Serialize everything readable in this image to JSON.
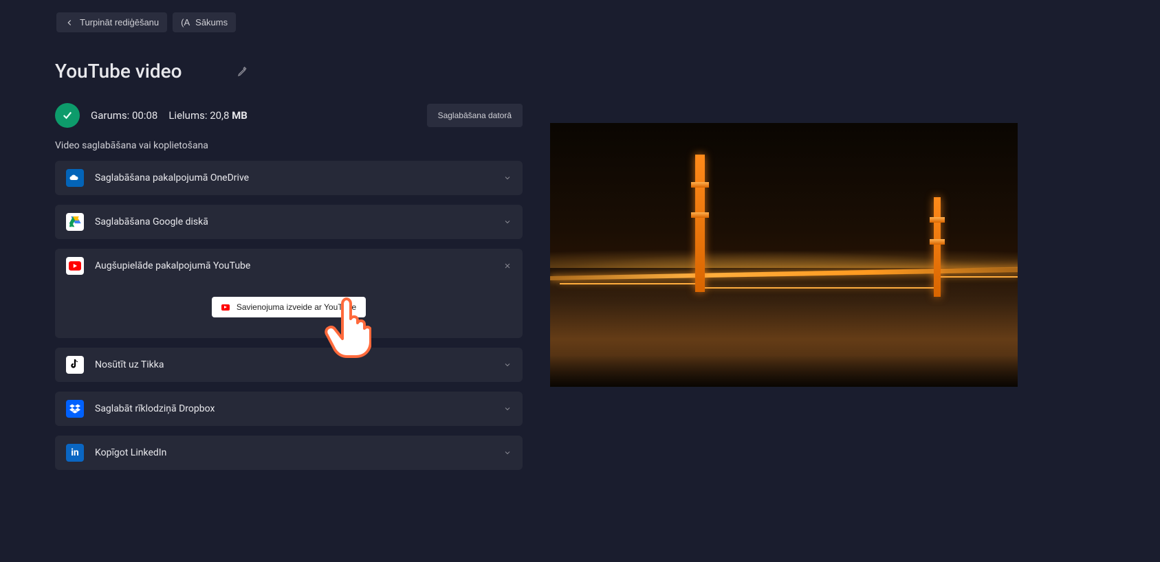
{
  "topbar": {
    "continue_editing": "Turpināt rediģēšanu",
    "home": "Sākums",
    "home_prefix": "(A"
  },
  "title": "YouTube video",
  "meta": {
    "duration_label": "Garums: 00:08",
    "size_label": "Lielums: 20,8",
    "size_unit": "MB"
  },
  "save_local_button": "Saglabāšana datorā",
  "subheading": "Video saglabāšana vai koplietošana",
  "options": [
    {
      "id": "onedrive",
      "label": "Saglabāšana pakalpojumā OneDrive",
      "expanded": false
    },
    {
      "id": "gdrive",
      "label": "Saglabāšana Google diskā",
      "expanded": false
    },
    {
      "id": "youtube",
      "label": "Augšupielāde pakalpojumā YouTube",
      "expanded": true,
      "connect_label": "Savienojuma izveide ar YouTube"
    },
    {
      "id": "tiktok",
      "label": "Nosūtīt uz Tikka",
      "expanded": false
    },
    {
      "id": "dropbox",
      "label": "Saglabāt rīklodziņā Dropbox",
      "expanded": false
    },
    {
      "id": "linkedin",
      "label": "Kopīgot LinkedIn",
      "expanded": false
    }
  ],
  "colors": {
    "bg": "#1a1d2e",
    "panel": "#262938",
    "accent_green": "#0d9b6b",
    "youtube_red": "#ff0000",
    "onedrive_blue": "#0364b8",
    "dropbox_blue": "#0061fe",
    "linkedin_blue": "#0a66c2"
  }
}
